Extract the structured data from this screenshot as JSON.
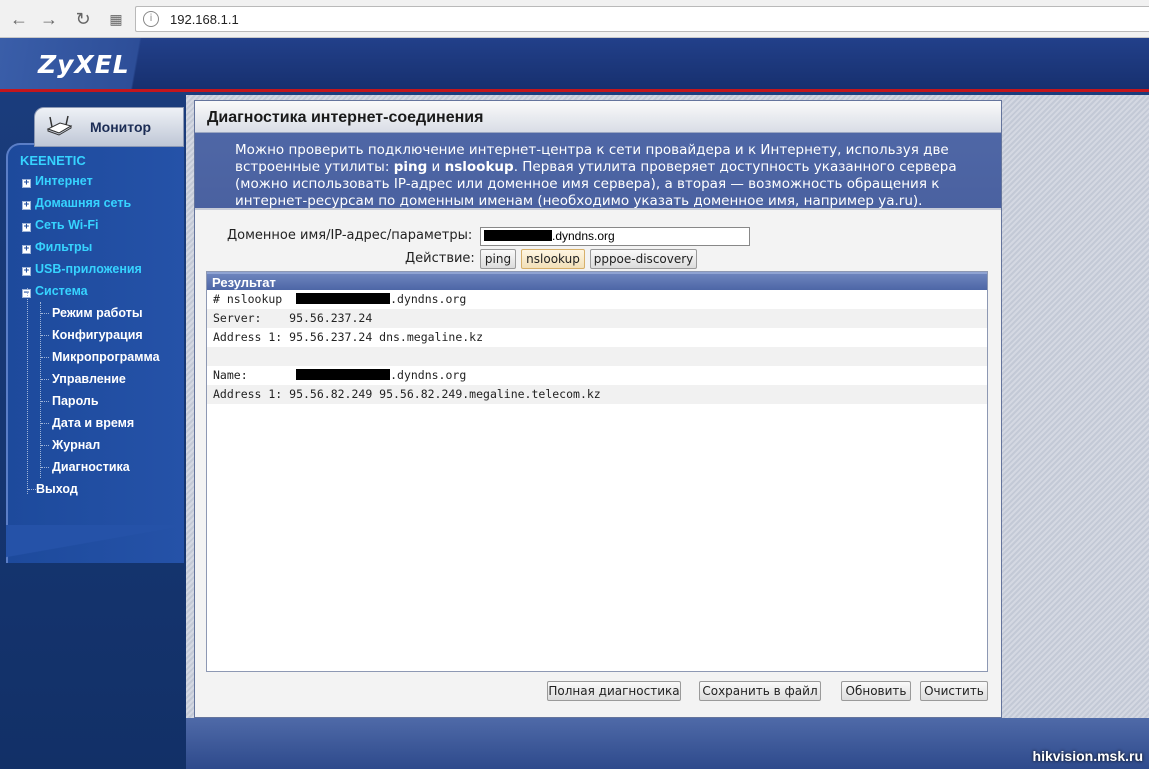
{
  "browser": {
    "url": "192.168.1.1",
    "back_icon": "back-arrow-icon",
    "forward_icon": "forward-arrow-icon",
    "reload_icon": "reload-icon",
    "apps_icon": "apps-grid-icon"
  },
  "header": {
    "logo": "ZyXEL",
    "accent_color": "#c4161c"
  },
  "sidebar": {
    "tab_label": "Монитор",
    "brand": "KEENETIC",
    "items": [
      {
        "label": "Интернет",
        "type": "top"
      },
      {
        "label": "Домашняя сеть",
        "type": "top"
      },
      {
        "label": "Сеть Wi-Fi",
        "type": "top"
      },
      {
        "label": "Фильтры",
        "type": "top"
      },
      {
        "label": "USB-приложения",
        "type": "top"
      },
      {
        "label": "Система",
        "type": "top",
        "expanded": true
      }
    ],
    "sub_items": [
      {
        "label": "Режим работы"
      },
      {
        "label": "Конфигурация"
      },
      {
        "label": "Микропрограмма"
      },
      {
        "label": "Управление"
      },
      {
        "label": "Пароль"
      },
      {
        "label": "Дата и время"
      },
      {
        "label": "Журнал"
      },
      {
        "label": "Диагностика"
      }
    ],
    "exit_label": "Выход"
  },
  "main": {
    "title": "Диагностика интернет-соединения",
    "description": {
      "part1": "Можно проверить подключение интернет-центра к сети провайдера и к Интернету, используя две встроенные утилиты: ",
      "ping": "ping",
      "and": " и ",
      "nslookup": "nslookup",
      "part2": ". Первая утилита проверяет доступность указанного сервера (можно использовать IP-адрес или доменное имя сервера), а вторая — возможность обращения к интернет-ресурсам по доменным именам (необходимо указать доменное имя, например ya.ru)."
    },
    "host_label": "Доменное имя/IP-адрес/параметры:",
    "host_value_suffix": ".dyndns.org",
    "action_label": "Действие:",
    "action_buttons": [
      "ping",
      "nslookup",
      "pppoe-discovery"
    ],
    "active_action": "nslookup",
    "result_title": "Результат",
    "result_rows": [
      {
        "prefix": "# nslookup  ",
        "suffix": ".dyndns.org"
      },
      {
        "text": "Server:    95.56.237.24"
      },
      {
        "text": "Address 1: 95.56.237.24 dns.megaline.kz"
      },
      {
        "text": ""
      },
      {
        "prefix": "Name:       ",
        "suffix": ".dyndns.org"
      },
      {
        "text": "Address 1: 95.56.82.249 95.56.82.249.megaline.telecom.kz"
      }
    ],
    "buttons": {
      "full_diag": "Полная диагностика",
      "save": "Сохранить в файл",
      "refresh": "Обновить",
      "clear": "Очистить"
    }
  },
  "watermark": "hikvision.msk.ru"
}
